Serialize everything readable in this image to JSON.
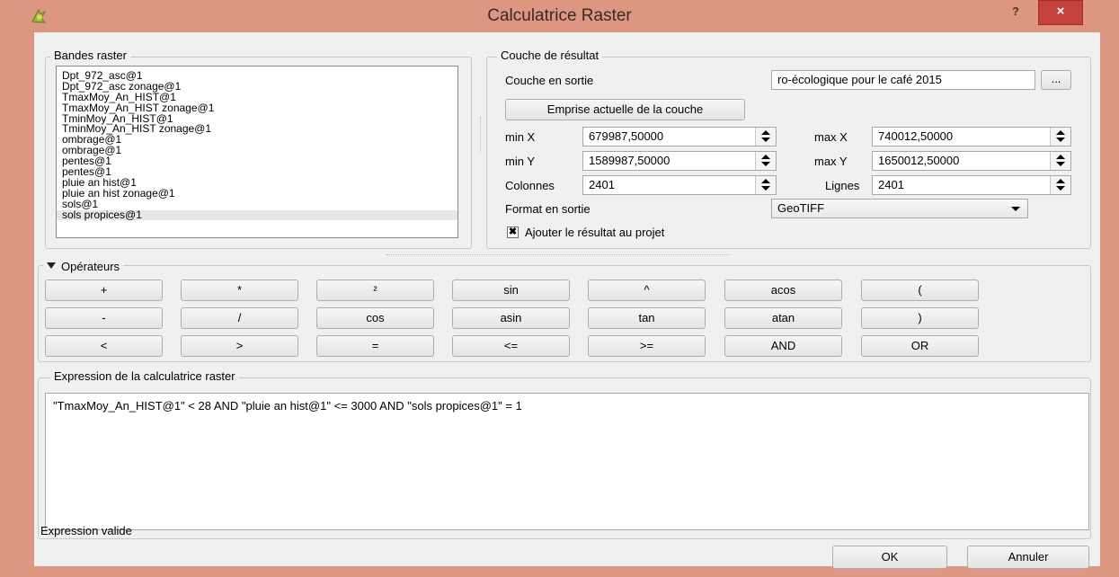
{
  "window": {
    "title": "Calculatrice Raster",
    "help_label": "?",
    "close_label": "×"
  },
  "bands": {
    "group_label": "Bandes raster",
    "items": [
      "Dpt_972_asc@1",
      "Dpt_972_asc zonage@1",
      "TmaxMoy_An_HIST@1",
      "TmaxMoy_An_HIST zonage@1",
      "TminMoy_An_HIST@1",
      "TminMoy_An_HIST zonage@1",
      "ombrage@1",
      "ombrage@1",
      "pentes@1",
      "pentes@1",
      "pluie an hist@1",
      "pluie an hist zonage@1",
      "sols@1",
      "sols propices@1"
    ],
    "selected_index": 13
  },
  "result": {
    "group_label": "Couche de résultat",
    "output_layer_label": "Couche en sortie",
    "output_layer_value": "ro-écologique pour le café 2015",
    "browse_label": "...",
    "extent_button": "Emprise actuelle de la couche",
    "min_x_label": "min X",
    "min_x_value": "679987,50000",
    "max_x_label": "max X",
    "max_x_value": "740012,50000",
    "min_y_label": "min Y",
    "min_y_value": "1589987,50000",
    "max_y_label": "max Y",
    "max_y_value": "1650012,50000",
    "columns_label": "Colonnes",
    "columns_value": "2401",
    "rows_label": "Lignes",
    "rows_value": "2401",
    "format_label": "Format en sortie",
    "format_value": "GeoTIFF",
    "add_to_project_label": "Ajouter le résultat au projet",
    "add_to_project_checked": true
  },
  "operators": {
    "group_label": "Opérateurs",
    "rows": [
      [
        "+",
        "*",
        "²",
        "sin",
        "^",
        "acos",
        "("
      ],
      [
        "-",
        "/",
        "cos",
        "asin",
        "tan",
        "atan",
        ")"
      ],
      [
        "<",
        ">",
        "=",
        "<=",
        ">=",
        "AND",
        "OR"
      ]
    ]
  },
  "expression": {
    "group_label": "Expression de la calculatrice raster",
    "text": "\"TmaxMoy_An_HIST@1\" < 28 AND \"pluie an hist@1\" <= 3000 AND \"sols propices@1\" = 1",
    "status": "Expression valide"
  },
  "footer": {
    "ok_label": "OK",
    "cancel_label": "Annuler"
  }
}
